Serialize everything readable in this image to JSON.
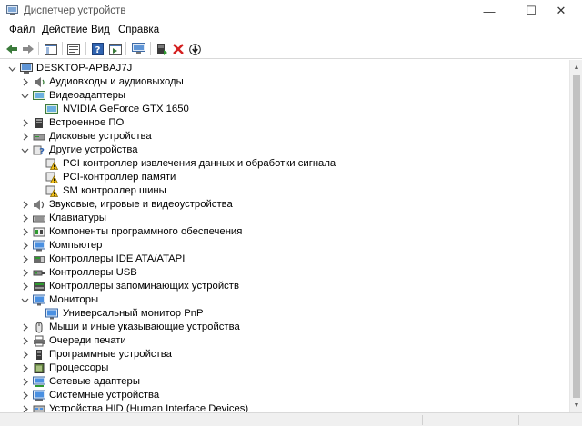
{
  "window": {
    "title": "Диспетчер устройств",
    "controls": {
      "minimize": "—",
      "maximize": "☐",
      "close": "✕"
    }
  },
  "menu": [
    "Файл",
    "Действие",
    "Вид",
    "Справка"
  ],
  "toolbar": {
    "buttons": [
      "back-icon",
      "forward-icon",
      "show-hide-console-tree-icon",
      "properties-icon",
      "help-icon",
      "show-action-pane-icon",
      "scan-hardware-icon",
      "update-driver-icon",
      "uninstall-device-icon",
      "disable-device-icon"
    ]
  },
  "tree": {
    "root": "DESKTOP-APBAJ7J",
    "items": [
      {
        "label": "Аудиовходы и аудиовыходы",
        "icon": "speaker-icon",
        "expanded": false
      },
      {
        "label": "Видеоадаптеры",
        "icon": "display-adapter-icon",
        "expanded": true
      },
      {
        "label": "NVIDIA GeForce GTX 1650",
        "icon": "display-adapter-icon",
        "child": true
      },
      {
        "label": "Встроенное ПО",
        "icon": "firmware-icon",
        "expanded": false
      },
      {
        "label": "Дисковые устройства",
        "icon": "disk-drive-icon",
        "expanded": false
      },
      {
        "label": "Другие устройства",
        "icon": "unknown-device-icon",
        "expanded": true
      },
      {
        "label": "PCI контроллер извлечения данных и обработки сигнала",
        "icon": "warning-device-icon",
        "child": true
      },
      {
        "label": "PCI-контроллер памяти",
        "icon": "warning-device-icon",
        "child": true
      },
      {
        "label": "SM контроллер шины",
        "icon": "warning-device-icon",
        "child": true
      },
      {
        "label": "Звуковые, игровые и видеоустройства",
        "icon": "sound-icon",
        "expanded": false
      },
      {
        "label": "Клавиатуры",
        "icon": "keyboard-icon",
        "expanded": false
      },
      {
        "label": "Компоненты программного обеспечения",
        "icon": "software-component-icon",
        "expanded": false
      },
      {
        "label": "Компьютер",
        "icon": "computer-icon",
        "expanded": false
      },
      {
        "label": "Контроллеры IDE ATA/ATAPI",
        "icon": "ide-controller-icon",
        "expanded": false
      },
      {
        "label": "Контроллеры USB",
        "icon": "usb-icon",
        "expanded": false
      },
      {
        "label": "Контроллеры запоминающих устройств",
        "icon": "storage-controller-icon",
        "expanded": false
      },
      {
        "label": "Мониторы",
        "icon": "monitor-icon",
        "expanded": true
      },
      {
        "label": "Универсальный монитор PnP",
        "icon": "monitor-icon",
        "child": true
      },
      {
        "label": "Мыши и иные указывающие устройства",
        "icon": "mouse-icon",
        "expanded": false
      },
      {
        "label": "Очереди печати",
        "icon": "printer-icon",
        "expanded": false
      },
      {
        "label": "Программные устройства",
        "icon": "software-device-icon",
        "expanded": false
      },
      {
        "label": "Процессоры",
        "icon": "processor-icon",
        "expanded": false
      },
      {
        "label": "Сетевые адаптеры",
        "icon": "network-adapter-icon",
        "expanded": false
      },
      {
        "label": "Системные устройства",
        "icon": "system-device-icon",
        "expanded": false
      },
      {
        "label": "Устройства HID (Human Interface Devices)",
        "icon": "hid-icon",
        "expanded": false
      }
    ]
  }
}
